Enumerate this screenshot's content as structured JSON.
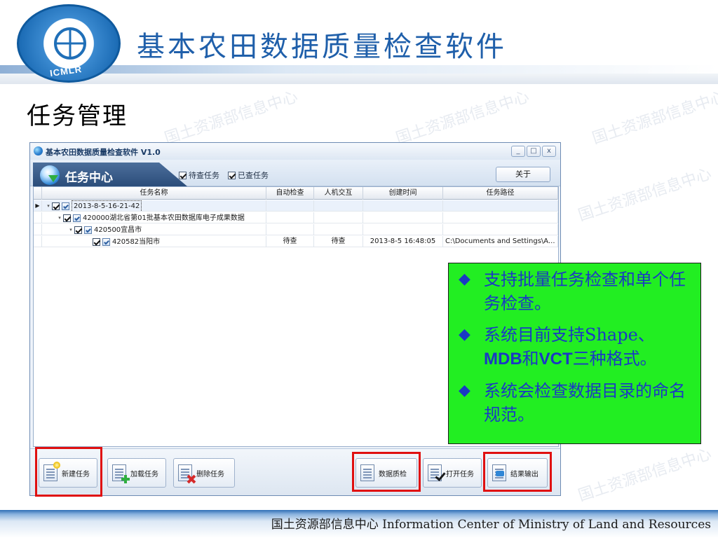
{
  "slide": {
    "title": "基本农田数据质量检查软件",
    "section_title": "任务管理",
    "footer": "国土资源部信息中心  Information Center of Ministry of Land and Resources",
    "logo_text": "ICMLR",
    "watermark_cn": "国土资源部信息中心",
    "watermark_en": "Information Center of Ministry of Land and Resources"
  },
  "app": {
    "title": "基本农田数据质量检查软件 V1.0",
    "window_buttons": [
      "_",
      "□",
      "x"
    ],
    "task_center_label": "任务中心",
    "filters": [
      {
        "label": "待查任务",
        "checked": true
      },
      {
        "label": "已查任务",
        "checked": true
      }
    ],
    "about_label": "关于",
    "columns": [
      "任务名称",
      "自动检查",
      "人机交互",
      "创建时间",
      "任务路径"
    ],
    "rows": [
      {
        "indicator": "▶",
        "expander": "▾",
        "name": "2013-8-5-16-21-42",
        "auto": "",
        "interactive": "",
        "created": "",
        "path": ""
      },
      {
        "indicator": "",
        "expander": "▾",
        "name": "420000湖北省第01批基本农田数据库电子成果数据",
        "auto": "",
        "interactive": "",
        "created": "",
        "path": ""
      },
      {
        "indicator": "",
        "expander": "▾",
        "name": "420500宜昌市",
        "auto": "",
        "interactive": "",
        "created": "",
        "path": ""
      },
      {
        "indicator": "",
        "expander": "",
        "name": "420582当阳市",
        "auto": "待查",
        "interactive": "待查",
        "created": "2013-8-5 16:48:05",
        "path": "C:\\Documents and Settings\\A..."
      }
    ],
    "toolbar": {
      "new_task": "新建任务",
      "load_task": "加载任务",
      "delete_task": "删除任务",
      "quality_check": "数据质检",
      "open_task": "打开任务",
      "export_result": "结果输出"
    }
  },
  "callout": {
    "bullet_mark": "◆",
    "bullet1": "支持批量任务检查和单个任务检查。",
    "bullet2_a": "系统目前支持Shape、",
    "bullet2_b1": "MDB",
    "bullet2_b2": "和",
    "bullet2_b3": "VCT",
    "bullet2_b4": "三种格式。",
    "bullet3": "系统会检查数据目录的命名规范。"
  },
  "colors": {
    "title_blue": "#1f5faa",
    "callout_green": "#22ee22",
    "callout_text": "#1a39c4",
    "highlight_red": "#e01010"
  }
}
